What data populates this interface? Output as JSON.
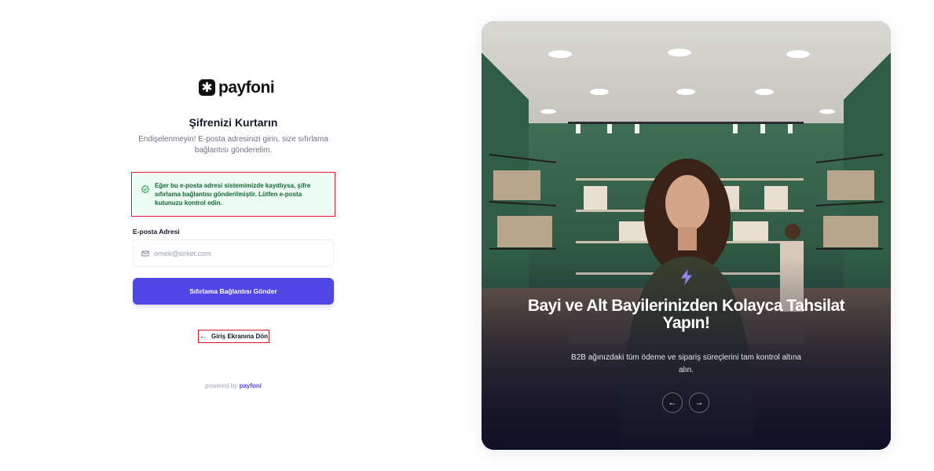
{
  "brand": {
    "logo_icon": "asterisk-logo-icon",
    "logo_text": "payfoni",
    "accent_color": "#4f46e5"
  },
  "recover": {
    "title": "Şifrenizi Kurtarın",
    "subtitle": "Endişelenmeyin! E-posta adresinizi girin, size sıfırlama bağlantısı gönderelim."
  },
  "alert": {
    "icon": "check-circle-icon",
    "message": "Eğer bu e-posta adresi sistemimizde kayıtlıysa, şifre sıfırlama bağlantısı gönderilmiştir. Lütfen e-posta kutunuzu kontrol edin.",
    "color": "#166534",
    "background": "#ecfdf3"
  },
  "form": {
    "email_label": "E-posta Adresi",
    "email_icon": "mail-icon",
    "email_value": "",
    "email_placeholder": "ornek@sirket.com",
    "submit_label": "Sıfırlama Bağlantısı Gönder"
  },
  "back": {
    "icon": "arrow-left-icon",
    "label": "Giriş Ekranına Dön"
  },
  "footer": {
    "powered_prefix": "powered by",
    "powered_brand": "payfoni"
  },
  "slide": {
    "icon": "lightning-bolt-icon",
    "title": "Bayi ve Alt Bayilerinizden Kolayca Tahsilat Yapın!",
    "description": "B2B ağınızdaki tüm ödeme ve sipariş süreçlerini tam kontrol altına alın.",
    "prev_icon": "arrow-left-icon",
    "next_icon": "arrow-right-icon"
  }
}
